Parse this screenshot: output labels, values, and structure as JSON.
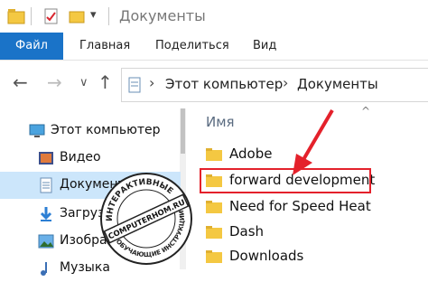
{
  "window": {
    "title": "Документы"
  },
  "ribbon": {
    "tabs": [
      "Файл",
      "Главная",
      "Поделиться",
      "Вид"
    ]
  },
  "address_bar": {
    "crumbs": [
      "Этот компьютер",
      "Документы"
    ]
  },
  "nav_pane": {
    "items": [
      {
        "label": "Этот компьютер",
        "icon": "computer-icon"
      },
      {
        "label": "Видео",
        "icon": "video-icon"
      },
      {
        "label": "Документы",
        "icon": "documents-icon",
        "selected": true
      },
      {
        "label": "Загрузки",
        "icon": "downloads-icon"
      },
      {
        "label": "Изображения",
        "icon": "pictures-icon"
      },
      {
        "label": "Музыка",
        "icon": "music-icon"
      }
    ]
  },
  "content": {
    "column_header": "Имя",
    "files": [
      "Adobe",
      "forward development",
      "Need for Speed Heat",
      "Dash",
      "Downloads"
    ],
    "highlighted_file": "forward development"
  },
  "watermark": {
    "site": "COMPUTERHOM.RU",
    "top_text": "ИНТЕРАКТИВНЫЕ",
    "bottom_text": "ОБУЧАЮЩИЕ ИНСТРУКЦИИ"
  },
  "colors": {
    "accent": "#1a73c8",
    "selection": "#cce6fb",
    "highlight_border": "#e4212b",
    "arrow": "#e4212b",
    "folder": "#f4c842"
  }
}
